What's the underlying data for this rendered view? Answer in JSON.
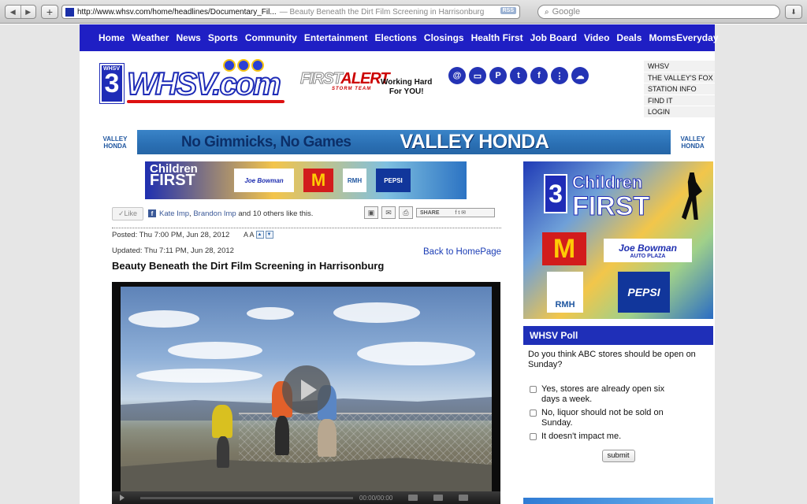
{
  "browser": {
    "url": "http://www.whsv.com/home/headlines/Documentary_Fil...",
    "page_title": "— Beauty Beneath the Dirt Film Screening in Harrisonburg",
    "rss_label": "RSS",
    "search_placeholder": "Google",
    "back_icon": "◀",
    "forward_icon": "▶",
    "add_icon": "+",
    "reload_icon": "↻",
    "download_icon": "⬇"
  },
  "nav": {
    "items": [
      "Home",
      "Weather",
      "News",
      "Sports",
      "Community",
      "Entertainment",
      "Elections",
      "Closings",
      "Health First",
      "Job Board",
      "Video",
      "Deals",
      "MomsEveryday"
    ]
  },
  "header": {
    "logo_number": "3",
    "logo_network": "WHSV",
    "logo_text": "WHSV.com",
    "first_alert": "FIRSTALERT",
    "first_alert_first": "FIRST",
    "first_alert_alert": "ALERT",
    "first_alert_sub": "STORM TEAM",
    "working_hard_1": "Working Hard",
    "working_hard_2": "For YOU!",
    "social_icons": [
      "email-alerts-icon",
      "mobile-icon",
      "pinterest-icon",
      "twitter-icon",
      "facebook-icon",
      "traffic-icon",
      "weather-app-icon"
    ],
    "side_links": [
      "WHSV",
      "THE VALLEY'S FOX",
      "STATION INFO",
      "FIND IT",
      "LOGIN"
    ]
  },
  "honda_banner": {
    "logo_line1": "VALLEY",
    "logo_line2": "HONDA",
    "slogan": "No Gimmicks, No Games",
    "dealer": "VALLEY HONDA"
  },
  "sponsor_strip": {
    "title_line1": "Children",
    "title_line2": "FIRST",
    "joe": "Joe Bowman",
    "mcd": "M",
    "rmh": "RMH",
    "pepsi": "PEPSI"
  },
  "social_bar": {
    "like_label": "Like",
    "like_names_1": "Kate Imp",
    "like_sep": ", ",
    "like_names_2": "Brandon Imp",
    "like_rest": " and 10 others like this.",
    "share_label": "SHARE"
  },
  "article": {
    "posted": "Posted: Thu 7:00 PM, Jun 28, 2012",
    "text_size_label": "A A",
    "updated": "Updated: Thu 7:11 PM, Jun 28, 2012",
    "back_link": "Back to HomePage",
    "title": "Beauty Beneath the Dirt Film Screening in Harrisonburg",
    "video_time": "00:00/00:00"
  },
  "right_ad": {
    "number": "3",
    "title_line1": "Children",
    "title_line2": "FIRST",
    "mcd": "M",
    "joe": "Joe Bowman",
    "joe_sub": "AUTO PLAZA",
    "rmh": "RMH",
    "pepsi": "PEPSI"
  },
  "poll": {
    "heading": "WHSV Poll",
    "question": "Do you think ABC stores should be open on Sunday?",
    "options": [
      "Yes, stores are already open six days a week.",
      "No, liquor should not be sold on Sunday.",
      "It doesn't impact me."
    ],
    "submit_label": "submit"
  }
}
